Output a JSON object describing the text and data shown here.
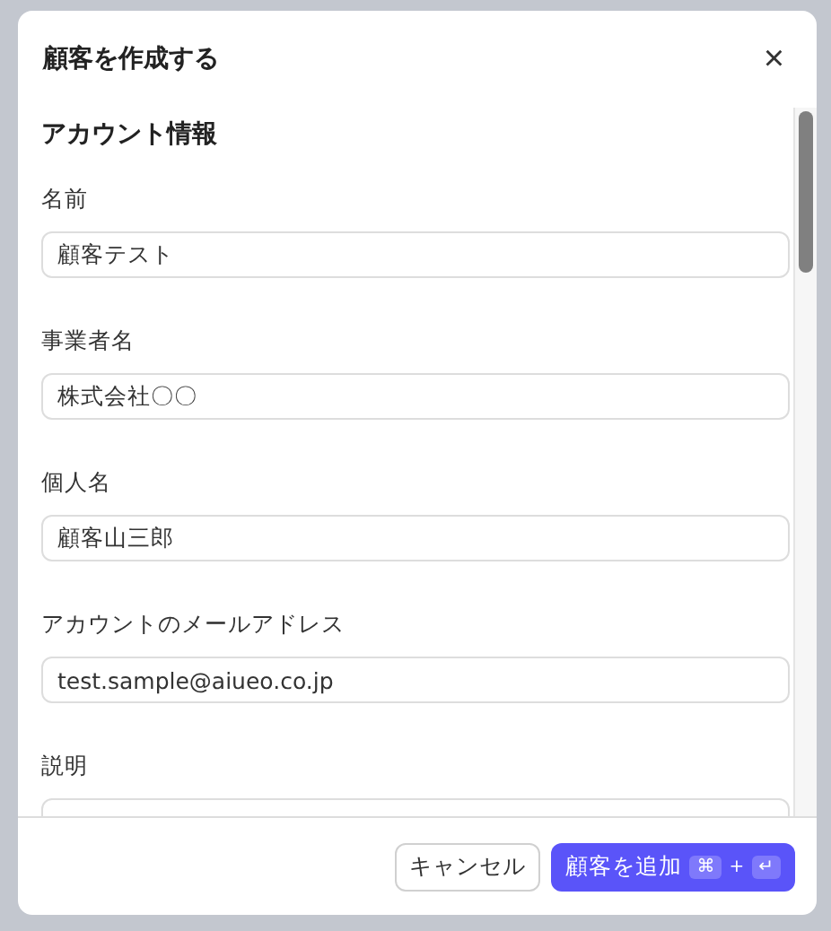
{
  "dialog": {
    "title": "顧客を作成する",
    "close": "×"
  },
  "section": {
    "title": "アカウント情報"
  },
  "fields": [
    {
      "label": "名前",
      "value": "顧客テスト"
    },
    {
      "label": "事業者名",
      "value": "株式会社〇〇"
    },
    {
      "label": "個人名",
      "value": "顧客山三郎"
    },
    {
      "label": "アカウントのメールアドレス",
      "value": "test.sample@aiueo.co.jp"
    },
    {
      "label": "説明"
    }
  ],
  "buttons": {
    "cancel": "キャンセル",
    "submit": "顧客を追加",
    "shortcut": [
      "⌘",
      "+",
      "↵"
    ]
  }
}
